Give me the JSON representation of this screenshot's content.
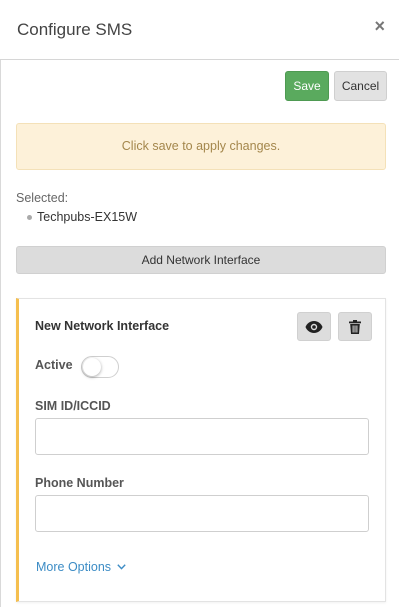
{
  "header": {
    "title": "Configure SMS",
    "close_glyph": "×"
  },
  "toolbar": {
    "save_label": "Save",
    "cancel_label": "Cancel"
  },
  "alert": {
    "text": "Click save to apply changes."
  },
  "selected": {
    "label": "Selected:",
    "items": [
      "Techpubs-EX15W"
    ]
  },
  "add_button": {
    "label": "Add Network Interface"
  },
  "card": {
    "title": "New Network Interface",
    "active_label": "Active",
    "active_on": false,
    "sim_label": "SIM ID/ICCID",
    "sim_value": "",
    "phone_label": "Phone Number",
    "phone_value": "",
    "more_options_label": "More Options",
    "icons": [
      "eye-icon",
      "trash-icon",
      "chevron-down-icon"
    ]
  },
  "colors": {
    "save": "#5aaa5e",
    "alert_bg": "#fdf1d9",
    "alert_text": "#a4874c",
    "card_accent": "#f5bf4f",
    "link": "#3c8cc5"
  }
}
